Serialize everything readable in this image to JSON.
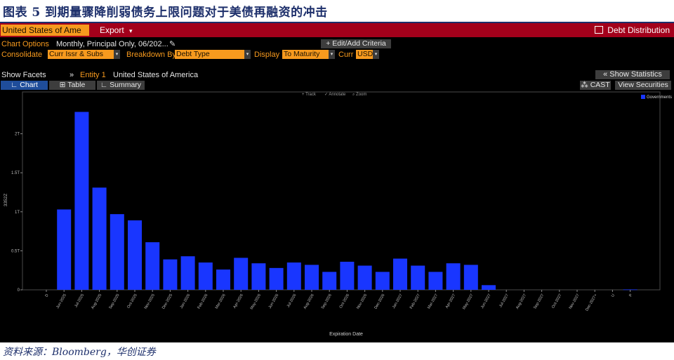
{
  "figure": {
    "title": "图表 5 到期量骤降削弱债务上限问题对于美债再融资的冲击",
    "source": "资料来源：Bloomberg，华创证券"
  },
  "colors": {
    "title_text": "#1d2f6b",
    "terminal_bg": "#000000",
    "header_red": "#a3001b",
    "bloomberg_orange": "#f79a1e",
    "tab_active": "#1f4d9a",
    "bar_blue": "#1936ff"
  },
  "toolbar": {
    "security": "United States of Ame",
    "export_label": "Export",
    "export_arrow": "▾",
    "debt_distribution": "Debt Distribution"
  },
  "options": {
    "chart_options_label": "Chart Options",
    "chart_options_value": "Monthly, Principal Only, 06/202...",
    "edit_criteria": "+ Edit/Add Criteria",
    "consolidate_label": "Consolidate",
    "consolidate_value": "Curr Issr & Subs",
    "breakdown_label": "Breakdown By",
    "breakdown_value": "Debt Type",
    "display_label": "Display",
    "display_value": "To Maturity",
    "curr_label": "Curr",
    "curr_value": "USD"
  },
  "facets": {
    "show_facets": "Show Facets",
    "entity_label": "Entity 1",
    "entity_value": "United States of America",
    "show_statistics": "« Show Statistics",
    "cast": "CAST",
    "view_securities": "View Securities"
  },
  "tabs": [
    {
      "label": "Chart",
      "active": true
    },
    {
      "label": "Table",
      "active": false
    },
    {
      "label": "Summary",
      "active": false
    }
  ],
  "mini_tools": [
    "Track",
    "Annotate",
    "Zoom"
  ],
  "chart_data": {
    "type": "bar",
    "xlabel": "Expiration Date",
    "ylabel": "3352Z",
    "ylim": [
      0,
      2.5
    ],
    "yticks": [
      {
        "value": 0,
        "label": "0"
      },
      {
        "value": 0.5,
        "label": "0.5T"
      },
      {
        "value": 1,
        "label": "1T"
      },
      {
        "value": 1.5,
        "label": "1.5T"
      },
      {
        "value": 2,
        "label": "2T"
      }
    ],
    "legend_position": "top-right",
    "categories": [
      "D",
      "Jun-2025",
      "Jul-2025",
      "Aug-2025",
      "Sep-2025",
      "Oct-2025",
      "Nov-2025",
      "Dec-2025",
      "Jan-2026",
      "Feb-2026",
      "Mar-2026",
      "Apr-2026",
      "May-2026",
      "Jun-2026",
      "Jul-2026",
      "Aug-2026",
      "Sep-2026",
      "Oct-2026",
      "Nov-2026",
      "Dec-2026",
      "Jan-2027",
      "Feb-2027",
      "Mar-2027",
      "Apr-2027",
      "May-2027",
      "Jun-2027",
      "Jul-2027",
      "Aug-2027",
      "Sep-2027",
      "Oct-2027",
      "Nov-2027",
      "Dec-2027+",
      "U",
      "P"
    ],
    "series": [
      {
        "name": "Governments",
        "color": "#1936ff",
        "values": [
          0,
          1.03,
          2.28,
          1.31,
          0.97,
          0.89,
          0.61,
          0.39,
          0.43,
          0.35,
          0.26,
          0.41,
          0.34,
          0.28,
          0.35,
          0.32,
          0.23,
          0.36,
          0.31,
          0.23,
          0.4,
          0.31,
          0.23,
          0.34,
          0.32,
          0.06,
          0,
          0,
          0,
          0,
          0,
          0,
          0,
          0.005
        ]
      }
    ]
  }
}
